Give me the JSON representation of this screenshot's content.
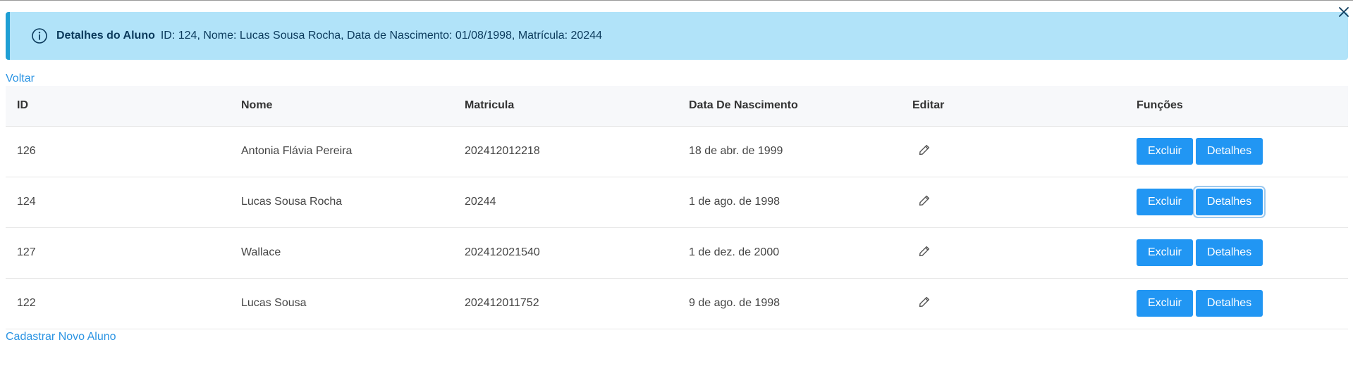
{
  "alert": {
    "title": "Detalhes do Aluno",
    "message": "ID: 124, Nome: Lucas Sousa Rocha, Data de Nascimento: 01/08/1998, Matrícula: 20244",
    "icon": "info-icon"
  },
  "nav": {
    "back_label": "Voltar",
    "new_student_label": "Cadastrar Novo Aluno"
  },
  "table": {
    "headers": {
      "id": "ID",
      "name": "Nome",
      "enrollment": "Matricula",
      "birth_date": "Data De Nascimento",
      "edit": "Editar",
      "actions": "Funções"
    },
    "rows": [
      {
        "id": "126",
        "name": "Antonia Flávia Pereira",
        "enrollment": "202412012218",
        "birth_date": "18 de abr. de 1999"
      },
      {
        "id": "124",
        "name": "Lucas Sousa Rocha",
        "enrollment": "20244",
        "birth_date": "1 de ago. de 1998"
      },
      {
        "id": "127",
        "name": "Wallace",
        "enrollment": "202412021540",
        "birth_date": "1 de dez. de 2000"
      },
      {
        "id": "122",
        "name": "Lucas Sousa",
        "enrollment": "202412011752",
        "birth_date": "9 de ago. de 1998"
      }
    ],
    "delete_label": "Excluir",
    "details_label": "Detalhes",
    "focused_row_id": "124"
  },
  "colors": {
    "alert_bg": "#b1e3f9",
    "alert_border": "#1f9fd4",
    "primary": "#2196f3",
    "link": "#2b94e3"
  }
}
